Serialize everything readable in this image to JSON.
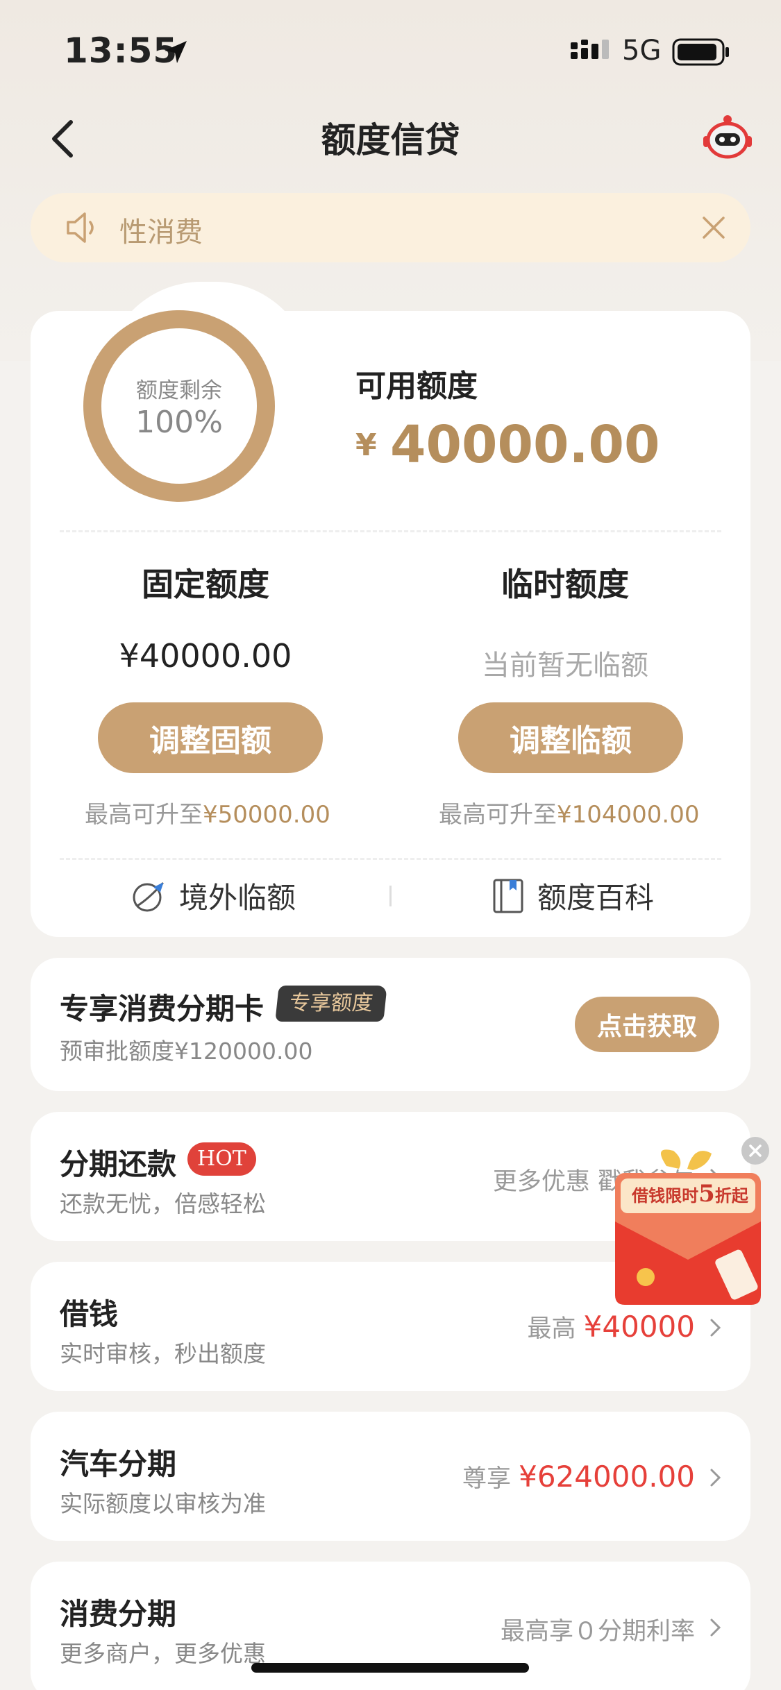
{
  "status_bar": {
    "time": "13:55",
    "network": "5G"
  },
  "header": {
    "title": "额度信贷"
  },
  "notice": {
    "text": "性消费"
  },
  "quota": {
    "ring_label": "额度剩余",
    "ring_value": "100%",
    "ring_fill_fraction": 1.0,
    "available_label": "可用额度",
    "available_currency": "¥",
    "available_value": "40000.00",
    "fixed": {
      "title": "固定额度",
      "value": "¥40000.00",
      "button": "调整固额",
      "limit_prefix": "最高可升至",
      "limit_value": "¥50000.00"
    },
    "temporary": {
      "title": "临时额度",
      "value": "当前暂无临额",
      "button": "调整临额",
      "limit_prefix": "最高可升至",
      "limit_value": "¥104000.00"
    },
    "links": [
      {
        "label": "境外临额",
        "icon": "globe-plane-icon"
      },
      {
        "label": "额度百科",
        "icon": "book-icon"
      }
    ]
  },
  "installment_card": {
    "title": "专享消费分期卡",
    "badge": "专享额度",
    "subtitle": "预审批额度¥120000.00",
    "button": "点击获取"
  },
  "services": [
    {
      "title": "分期还款",
      "badge": "HOT",
      "subtitle": "还款无忧，倍感轻松",
      "right_text": "更多优惠 戳我参与",
      "right_highlight": ""
    },
    {
      "title": "借钱",
      "subtitle": "实时审核，秒出额度",
      "right_text": "最高",
      "right_highlight": "¥40000"
    },
    {
      "title": "汽车分期",
      "subtitle": "实际额度以审核为准",
      "right_text": "尊享",
      "right_highlight": "¥624000.00"
    },
    {
      "title": "消费分期",
      "subtitle": "更多商户，更多优惠",
      "right_text": "最高享０分期利率",
      "right_highlight": ""
    }
  ],
  "promo": {
    "text_a": "借钱限时",
    "text_num": "5",
    "text_b": "折起"
  },
  "colors": {
    "gold": "#c9a173",
    "gold_text": "#b58e5c",
    "red": "#e6403a",
    "notice_bg": "#fbf0de"
  }
}
